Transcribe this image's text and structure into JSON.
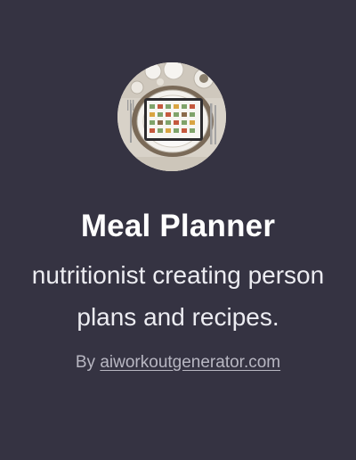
{
  "gpt": {
    "name": "Meal Planner",
    "description_line1": "nutritionist creating person",
    "description_line2": "plans and recipes.",
    "by_prefix": "By",
    "author_link": "aiworkoutgenerator.com"
  },
  "colors": {
    "background": "#353342",
    "title": "#ffffff",
    "description": "#ececf1",
    "byline": "#b8b7c2"
  },
  "icons": {
    "avatar": "meal-planner-avatar"
  }
}
